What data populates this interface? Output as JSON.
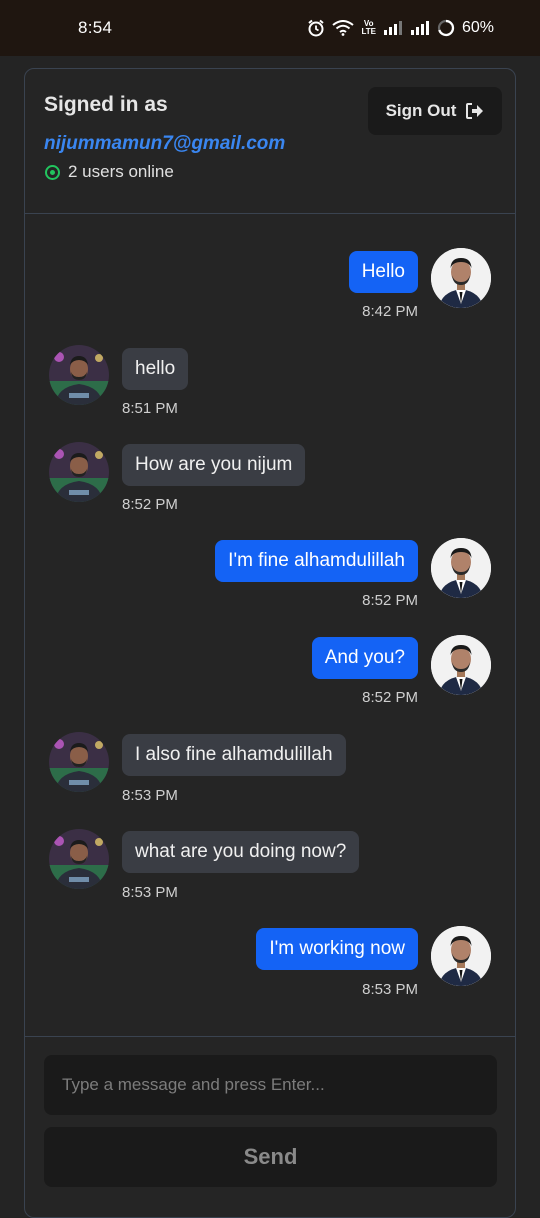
{
  "status_bar": {
    "time": "8:54",
    "volte_top": "Vo",
    "volte_bottom": "LTE",
    "battery": "60%"
  },
  "header": {
    "signed_in_label": "Signed in as",
    "email": "nijummamun7@gmail.com",
    "online_text": "2 users online",
    "sign_out_label": "Sign Out"
  },
  "messages": [
    {
      "text": "Hello",
      "time": "8:42 PM",
      "direction": "out"
    },
    {
      "text": "hello",
      "time": "8:51 PM",
      "direction": "in"
    },
    {
      "text": "How are you nijum",
      "time": "8:52 PM",
      "direction": "in"
    },
    {
      "text": "I'm fine alhamdulillah",
      "time": "8:52 PM",
      "direction": "out"
    },
    {
      "text": "And you?",
      "time": "8:52 PM",
      "direction": "out"
    },
    {
      "text": "I also fine alhamdulillah",
      "time": "8:53 PM",
      "direction": "in"
    },
    {
      "text": "what are you doing now?",
      "time": "8:53 PM",
      "direction": "in"
    },
    {
      "text": "I'm working now",
      "time": "8:53 PM",
      "direction": "out"
    }
  ],
  "composer": {
    "placeholder": "Type a message and press Enter...",
    "value": "",
    "send_label": "Send"
  },
  "colors": {
    "accent": "#1463f5",
    "email": "#3a86f0",
    "online": "#22c55e",
    "incoming_bubble": "#3a3d44"
  }
}
